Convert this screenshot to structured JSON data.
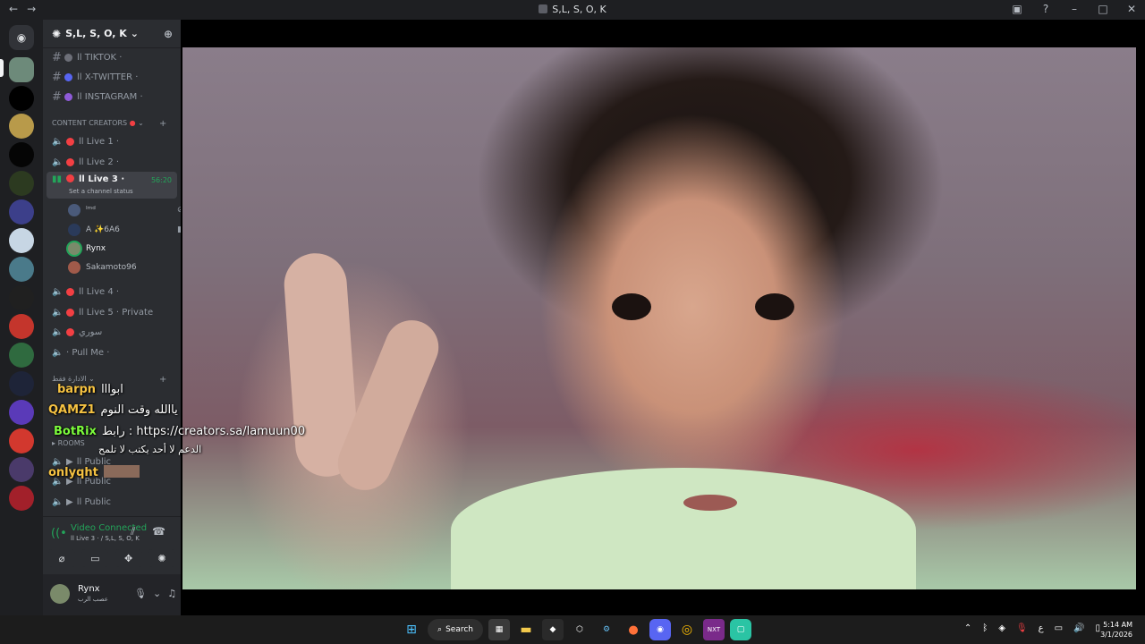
{
  "window": {
    "title": "S,L, S, O, K"
  },
  "server": {
    "name": "S,L, S, O, K"
  },
  "text_channels": [
    {
      "label": "اا TIKTOK ·"
    },
    {
      "label": "اا X-TWITTER ·"
    },
    {
      "label": "اا INSTAGRAM ·"
    }
  ],
  "category_creators": "CONTENT CREATORS",
  "voice_channels": [
    {
      "label": "اا Live 1 ·"
    },
    {
      "label": "اا Live 2 ·"
    },
    {
      "label": "اا Live 3 ·",
      "timer": "56:20",
      "status": "Set a channel status"
    },
    {
      "label": "اا Live 4 ·"
    },
    {
      "label": "اا Live 5 · Private"
    },
    {
      "label": "سوري"
    },
    {
      "label": "· Pull Me ·"
    }
  ],
  "voice_users": [
    {
      "name": "ᴵᵐᵈ"
    },
    {
      "name": "A ✨6A6"
    },
    {
      "name": "Rynx"
    },
    {
      "name": "Sakamoto96"
    }
  ],
  "category_admin": "الادارة فقط",
  "category_rooms": "ROOMS",
  "public_channels": [
    {
      "label": "اا Public"
    },
    {
      "label": "اا Public"
    },
    {
      "label": "اا Public"
    }
  ],
  "voice_connection": {
    "title": "Video Connected",
    "subtitle": "اا Live 3 · / S,L, S, O, K"
  },
  "user_panel": {
    "name": "Rynx",
    "status": "عصب الرب"
  },
  "chat_overlay": [
    {
      "name": "barpn",
      "name_color": "#f5c242",
      "text": "ابوااا"
    },
    {
      "name": "QAMZ1",
      "name_color": "#f5c242",
      "text": "ياالله وقت النوم"
    },
    {
      "name": "BotRix",
      "name_color": "#7cfc3c",
      "text": "رابط : https://creators.sa/lamuun00"
    },
    {
      "name": "",
      "name_color": "#ffffff",
      "text": "الدعم لا أحد يكتب لا تلمح"
    },
    {
      "name": "onlyqht",
      "name_color": "#f5c242",
      "text": ""
    }
  ],
  "taskbar": {
    "search_label": "Search",
    "time": "5:14 AM",
    "date": "3/1/2026"
  },
  "colors": {
    "accent_green": "#23a55a",
    "live_red": "#f23f43",
    "blurple": "#5865f2"
  }
}
